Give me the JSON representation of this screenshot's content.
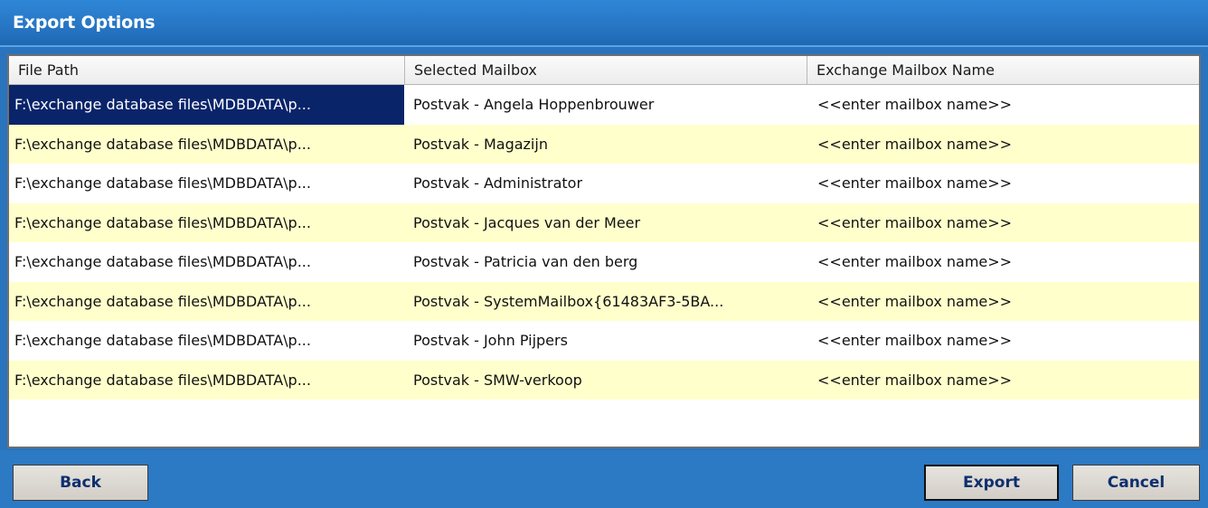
{
  "window": {
    "title": "Export Options"
  },
  "table": {
    "columns": [
      "File Path",
      "Selected Mailbox",
      "Exchange Mailbox Name"
    ],
    "rows": [
      {
        "file_path": "F:\\exchange database files\\MDBDATA\\p...",
        "selected_mailbox": "Postvak - Angela Hoppenbrouwer",
        "exchange_mailbox_name": "<<enter mailbox name>>",
        "selected": true
      },
      {
        "file_path": "F:\\exchange database files\\MDBDATA\\p...",
        "selected_mailbox": "Postvak - Magazijn",
        "exchange_mailbox_name": "<<enter mailbox name>>",
        "selected": false
      },
      {
        "file_path": "F:\\exchange database files\\MDBDATA\\p...",
        "selected_mailbox": "Postvak - Administrator",
        "exchange_mailbox_name": "<<enter mailbox name>>",
        "selected": false
      },
      {
        "file_path": "F:\\exchange database files\\MDBDATA\\p...",
        "selected_mailbox": "Postvak - Jacques van der Meer",
        "exchange_mailbox_name": "<<enter mailbox name>>",
        "selected": false
      },
      {
        "file_path": "F:\\exchange database files\\MDBDATA\\p...",
        "selected_mailbox": "Postvak - Patricia van den berg",
        "exchange_mailbox_name": "<<enter mailbox name>>",
        "selected": false
      },
      {
        "file_path": "F:\\exchange database files\\MDBDATA\\p...",
        "selected_mailbox": "Postvak - SystemMailbox{61483AF3-5BA...",
        "exchange_mailbox_name": "<<enter mailbox name>>",
        "selected": false
      },
      {
        "file_path": "F:\\exchange database files\\MDBDATA\\p...",
        "selected_mailbox": "Postvak - John Pijpers",
        "exchange_mailbox_name": "<<enter mailbox name>>",
        "selected": false
      },
      {
        "file_path": "F:\\exchange database files\\MDBDATA\\p...",
        "selected_mailbox": "Postvak - SMW-verkoop",
        "exchange_mailbox_name": "<<enter mailbox name>>",
        "selected": false
      }
    ]
  },
  "buttons": {
    "back": "Back",
    "export": "Export",
    "cancel": "Cancel"
  },
  "colors": {
    "title_bar": "#2777c6",
    "row_alt": "#ffffcc",
    "selection": "#0a246a"
  }
}
